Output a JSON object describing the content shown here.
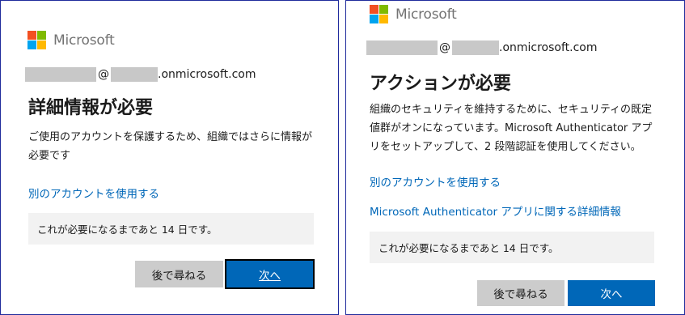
{
  "brand": {
    "name": "Microsoft",
    "colors": {
      "red": "#f25022",
      "green": "#7fba00",
      "blue": "#00a4ef",
      "yellow": "#ffb900"
    }
  },
  "left": {
    "account": {
      "at": "@",
      "domain_suffix": ".onmicrosoft.com"
    },
    "title": "詳細情報が必要",
    "description": "ご使用のアカウントを保護するため、組織ではさらに情報が必要です",
    "other_account_link": "別のアカウントを使用する",
    "notice": "これが必要になるまであと 14 日です。",
    "buttons": {
      "later": "後で尋ねる",
      "next": "次へ"
    }
  },
  "right": {
    "account": {
      "at": "@",
      "domain_suffix": ".onmicrosoft.com"
    },
    "title": "アクションが必要",
    "description": "組織のセキュリティを維持するために、セキュリティの既定値群がオンになっています。Microsoft Authenticator アプリをセットアップして、2 段階認証を使用してください。",
    "other_account_link": "別のアカウントを使用する",
    "authenticator_link": "Microsoft Authenticator アプリに関する詳細情報",
    "notice": "これが必要になるまであと 14 日です。",
    "buttons": {
      "later": "後で尋ねる",
      "next": "次へ"
    }
  },
  "colors": {
    "link": "#0067b8",
    "primary_button": "#0067b8",
    "secondary_button": "#cccccc",
    "notice_background": "#f2f2f2",
    "panel_border": "#1f2b9c"
  }
}
